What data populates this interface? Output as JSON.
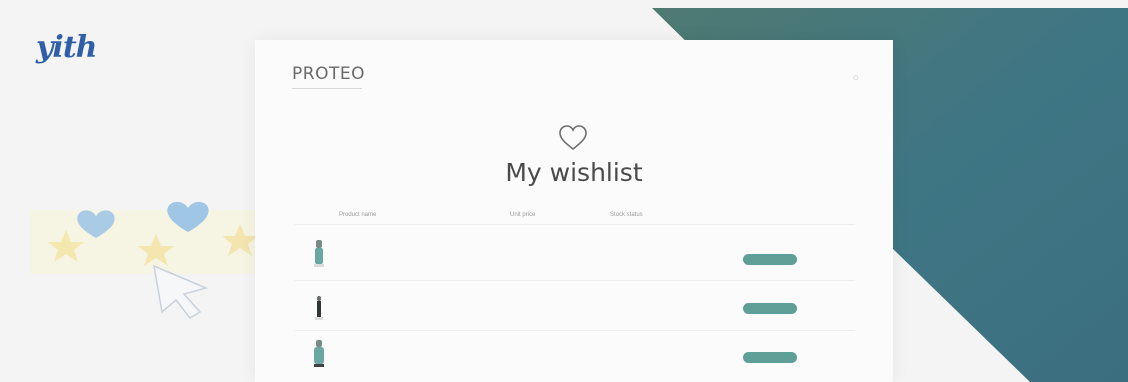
{
  "logo": {
    "text": "yith"
  },
  "store": {
    "brand": "PROTEO",
    "nav": [
      "",
      "",
      ""
    ],
    "breadcrumb": "",
    "title": "My wishlist",
    "columns": [
      "Product name",
      "Unit price",
      "Stock status"
    ],
    "rows": [
      {
        "name": "",
        "price": "",
        "stock": "",
        "note": "",
        "button": ""
      },
      {
        "name": "",
        "price": "",
        "stock": "",
        "note": "",
        "button": ""
      },
      {
        "name": "",
        "price": "",
        "stock": "",
        "note": "",
        "button": ""
      }
    ]
  },
  "colors": {
    "teal": "#3f7684",
    "accent_button": "#5e9f98",
    "logo_blue": "#2f5fa8"
  },
  "icons": [
    "heart-icon",
    "cursor-icon",
    "account-icon"
  ]
}
